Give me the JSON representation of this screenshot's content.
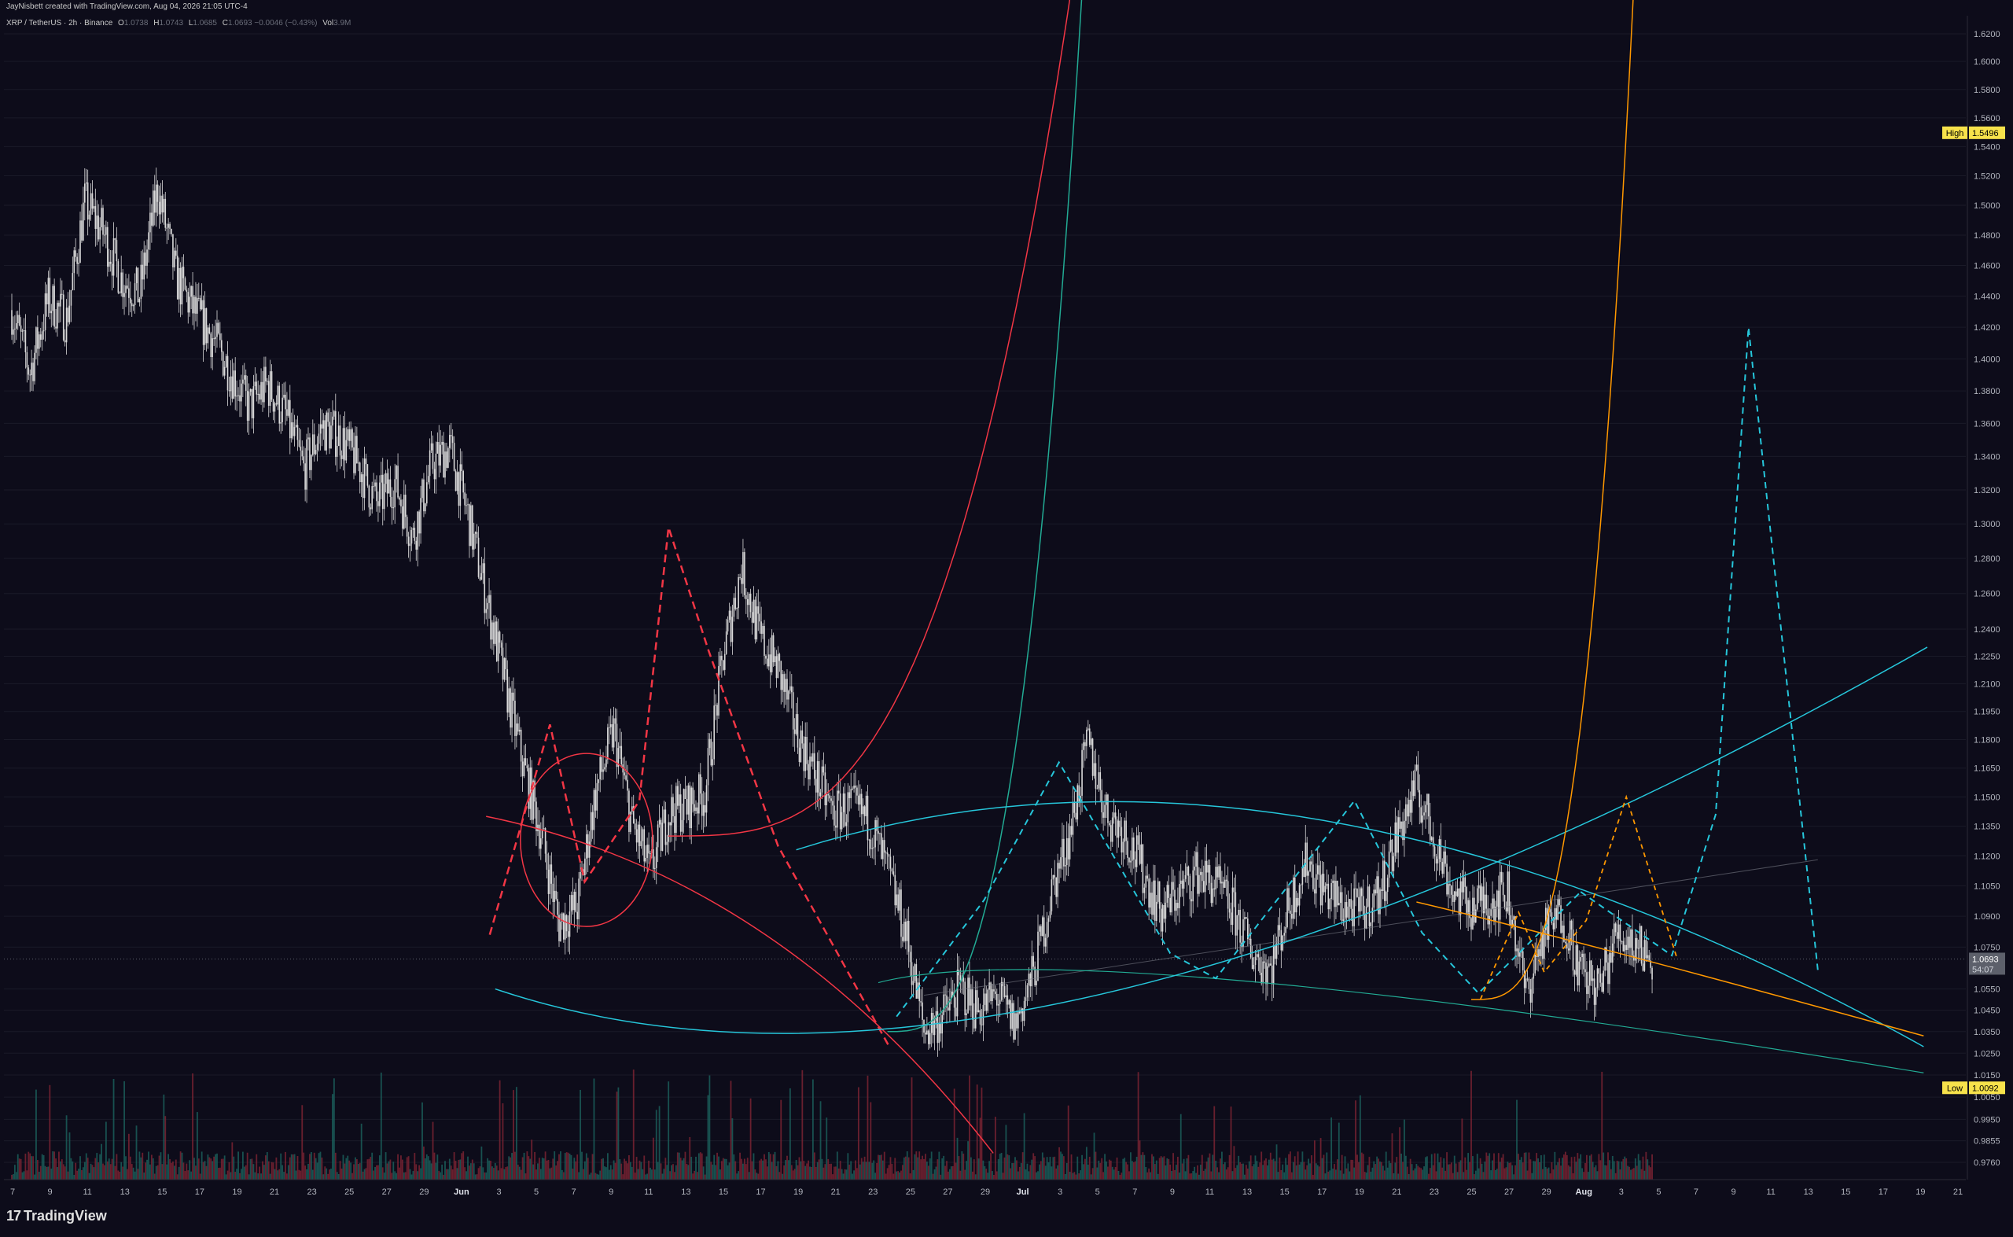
{
  "header": {
    "attribution": "JayNisbett created with TradingView.com, Aug 04, 2026 21:05 UTC-4"
  },
  "legend": {
    "symbol": "XRP / TetherUS · 2h · Binance",
    "open_label": "O",
    "open": "1.0738",
    "high_label": "H",
    "high": "1.0743",
    "low_label": "L",
    "low": "1.0685",
    "close_label": "C",
    "close": "1.0693",
    "change": "−0.0046 (−0.43%)",
    "vol_label": "Vol",
    "vol": "3.9M"
  },
  "footer": {
    "brand": "TradingView"
  },
  "chart_data": {
    "type": "candlestick",
    "symbol": "XRP / TetherUS",
    "interval": "2h",
    "exchange": "Binance",
    "y_axis_ticks": [
      "1.6200",
      "1.6000",
      "1.5800",
      "1.5600",
      "1.5400",
      "1.5200",
      "1.5000",
      "1.4800",
      "1.4600",
      "1.4400",
      "1.4200",
      "1.4000",
      "1.3800",
      "1.3600",
      "1.3400",
      "1.3200",
      "1.3000",
      "1.2800",
      "1.2600",
      "1.2400",
      "1.2250",
      "1.2100",
      "1.1950",
      "1.1800",
      "1.1650",
      "1.1500",
      "1.1350",
      "1.1200",
      "1.1050",
      "1.0900",
      "1.0750",
      "1.0550",
      "1.0450",
      "1.0350",
      "1.0250",
      "1.0150",
      "1.0050",
      "0.9950",
      "0.9855",
      "0.9760"
    ],
    "y_axis_scale": "log",
    "x_axis_ticks": [
      "7",
      "9",
      "11",
      "13",
      "15",
      "17",
      "19",
      "21",
      "23",
      "25",
      "27",
      "29",
      "Jun",
      "3",
      "5",
      "7",
      "9",
      "11",
      "13",
      "15",
      "17",
      "19",
      "21",
      "23",
      "25",
      "27",
      "29",
      "Jul",
      "3",
      "5",
      "7",
      "9",
      "11",
      "13",
      "15",
      "17",
      "19",
      "21",
      "23",
      "25",
      "27",
      "29",
      "Aug",
      "3",
      "5",
      "7",
      "9",
      "11",
      "13",
      "15",
      "17",
      "19",
      "21"
    ],
    "bold_x_ticks": [
      "Jun",
      "Jul",
      "Aug"
    ],
    "price_markers": [
      {
        "label": "High",
        "value": "1.5496",
        "color": "#f7e24b"
      },
      {
        "label": "Low",
        "value": "1.0092",
        "color": "#f7e24b"
      },
      {
        "label": "",
        "value": "1.0693",
        "sub": "54:07",
        "color": "#5d606b"
      }
    ],
    "price_path": [
      [
        "May 6",
        1.431
      ],
      [
        "May 7",
        1.392
      ],
      [
        "May 8",
        1.438
      ],
      [
        "May 9",
        1.425
      ],
      [
        "May 10",
        1.502
      ],
      [
        "May 11",
        1.482
      ],
      [
        "May 12",
        1.452
      ],
      [
        "May 13",
        1.441
      ],
      [
        "May 14",
        1.512
      ],
      [
        "May 15",
        1.452
      ],
      [
        "May 16",
        1.43
      ],
      [
        "May 17",
        1.414
      ],
      [
        "May 18",
        1.392
      ],
      [
        "May 19",
        1.37
      ],
      [
        "May 20",
        1.384
      ],
      [
        "May 21",
        1.365
      ],
      [
        "May 22",
        1.332
      ],
      [
        "May 23",
        1.358
      ],
      [
        "May 24",
        1.352
      ],
      [
        "May 25",
        1.335
      ],
      [
        "May 26",
        1.312
      ],
      [
        "May 27",
        1.325
      ],
      [
        "May 28",
        1.292
      ],
      [
        "May 29",
        1.335
      ],
      [
        "May 30",
        1.345
      ],
      [
        "May 31",
        1.305
      ],
      [
        "Jun 1",
        1.258
      ],
      [
        "Jun 2",
        1.212
      ],
      [
        "Jun 3",
        1.168
      ],
      [
        "Jun 4",
        1.132
      ],
      [
        "Jun 5",
        1.086
      ],
      [
        "Jun 6",
        1.095
      ],
      [
        "Jun 7",
        1.152
      ],
      [
        "Jun 8",
        1.185
      ],
      [
        "Jun 9",
        1.136
      ],
      [
        "Jun 10",
        1.112
      ],
      [
        "Jun 11",
        1.142
      ],
      [
        "Jun 12",
        1.145
      ],
      [
        "Jun 13",
        1.152
      ],
      [
        "Jun 14",
        1.225
      ],
      [
        "Jun 15",
        1.275
      ],
      [
        "Jun 16",
        1.235
      ],
      [
        "Jun 17",
        1.218
      ],
      [
        "Jun 18",
        1.185
      ],
      [
        "Jun 19",
        1.162
      ],
      [
        "Jun 20",
        1.142
      ],
      [
        "Jun 21",
        1.145
      ],
      [
        "Jun 22",
        1.138
      ],
      [
        "Jun 23",
        1.112
      ],
      [
        "Jun 24",
        1.082
      ],
      [
        "Jun 25",
        1.035
      ],
      [
        "Jun 26",
        1.042
      ],
      [
        "Jun 27",
        1.055
      ],
      [
        "Jun 28",
        1.045
      ],
      [
        "Jun 29",
        1.052
      ],
      [
        "Jun 30",
        1.038
      ],
      [
        "Jul 1",
        1.062
      ],
      [
        "Jul 2",
        1.102
      ],
      [
        "Jul 3",
        1.132
      ],
      [
        "Jul 4",
        1.178
      ],
      [
        "Jul 5",
        1.142
      ],
      [
        "Jul 6",
        1.132
      ],
      [
        "Jul 7",
        1.112
      ],
      [
        "Jul 8",
        1.092
      ],
      [
        "Jul 9",
        1.102
      ],
      [
        "Jul 10",
        1.112
      ],
      [
        "Jul 11",
        1.105
      ],
      [
        "Jul 12",
        1.092
      ],
      [
        "Jul 13",
        1.072
      ],
      [
        "Jul 14",
        1.065
      ],
      [
        "Jul 15",
        1.095
      ],
      [
        "Jul 16",
        1.118
      ],
      [
        "Jul 17",
        1.102
      ],
      [
        "Jul 18",
        1.095
      ],
      [
        "Jul 19",
        1.092
      ],
      [
        "Jul 20",
        1.102
      ],
      [
        "Jul 21",
        1.132
      ],
      [
        "Jul 22",
        1.155
      ],
      [
        "Jul 23",
        1.128
      ],
      [
        "Jul 24",
        1.102
      ],
      [
        "Jul 25",
        1.095
      ],
      [
        "Jul 26",
        1.098
      ],
      [
        "Jul 27",
        1.102
      ],
      [
        "Jul 28",
        1.052
      ],
      [
        "Jul 29",
        1.082
      ],
      [
        "Jul 30",
        1.092
      ],
      [
        "Jul 31",
        1.062
      ],
      [
        "Aug 1",
        1.055
      ],
      [
        "Aug 2",
        1.082
      ],
      [
        "Aug 3",
        1.077
      ],
      [
        "Aug 4",
        1.069
      ]
    ],
    "drawings": [
      {
        "name": "red-arc",
        "color": "#f23645",
        "style": "solid"
      },
      {
        "name": "red-zigzag",
        "color": "#f23645",
        "style": "dashed"
      },
      {
        "name": "red-parabola",
        "color": "#f23645",
        "style": "solid"
      },
      {
        "name": "teal-parabola",
        "color": "#22ab94",
        "style": "solid"
      },
      {
        "name": "blue-arc",
        "color": "#26c6da",
        "style": "solid"
      },
      {
        "name": "blue-zigzag",
        "color": "#26c6da",
        "style": "dashed"
      },
      {
        "name": "blue-projection",
        "color": "#26c6da",
        "style": "dashed"
      },
      {
        "name": "orange-parabola",
        "color": "#ff9800",
        "style": "solid"
      },
      {
        "name": "orange-zigzag",
        "color": "#ff9800",
        "style": "dashed"
      },
      {
        "name": "gray-trendline",
        "color": "#787b86",
        "style": "solid"
      }
    ],
    "colors": {
      "background": "#0d0c1a",
      "candles": "#d9d9d9",
      "volume_up": "#1b5e5a",
      "volume_down": "#7a2332",
      "grid": "#1a1a28"
    }
  }
}
